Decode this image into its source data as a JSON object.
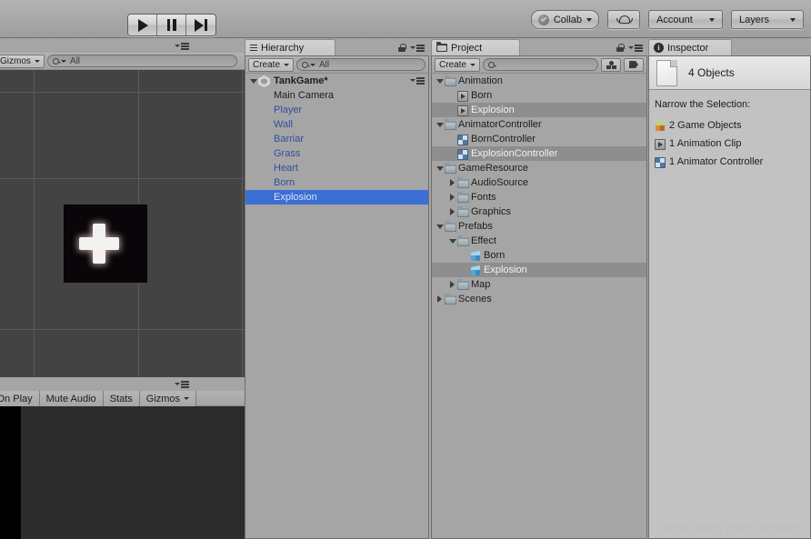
{
  "toolbar": {
    "play_icon": "play-icon",
    "pause_icon": "pause-icon",
    "step_icon": "step-icon",
    "collab_label": "Collab",
    "cloud_icon": "cloud-icon",
    "account_label": "Account",
    "layers_label": "Layers"
  },
  "scene_view": {
    "gizmos_label": "Gizmos",
    "search_value": "All",
    "sprite_name": "explosion-sprite"
  },
  "game_view": {
    "buttons": [
      "Maximize On Play",
      "Mute Audio",
      "Stats",
      "Gizmos"
    ]
  },
  "hierarchy": {
    "tab_label": "Hierarchy",
    "create_label": "Create",
    "search_value": "All",
    "scene_name": "TankGame*",
    "items": [
      {
        "label": "Main Camera",
        "style": "plain",
        "selected": false
      },
      {
        "label": "Player",
        "style": "prefab",
        "selected": false
      },
      {
        "label": "Wall",
        "style": "prefab",
        "selected": false
      },
      {
        "label": "Barriar",
        "style": "prefab",
        "selected": false
      },
      {
        "label": "Grass",
        "style": "prefab",
        "selected": false
      },
      {
        "label": "Heart",
        "style": "prefab",
        "selected": false
      },
      {
        "label": "Born",
        "style": "prefab",
        "selected": false
      },
      {
        "label": "Explosion",
        "style": "prefab",
        "selected": true
      }
    ]
  },
  "project": {
    "tab_label": "Project",
    "create_label": "Create",
    "search_placeholder": "",
    "items": [
      {
        "label": "Animation",
        "depth": 0,
        "twisty": "down",
        "icon": "folder",
        "selected": false
      },
      {
        "label": "Born",
        "depth": 1,
        "twisty": "none",
        "icon": "clip",
        "selected": false
      },
      {
        "label": "Explosion",
        "depth": 1,
        "twisty": "none",
        "icon": "clip",
        "selected": true
      },
      {
        "label": "AnimatorController",
        "depth": 0,
        "twisty": "down",
        "icon": "folder",
        "selected": false
      },
      {
        "label": "BornController",
        "depth": 1,
        "twisty": "none",
        "icon": "anim",
        "selected": false
      },
      {
        "label": "ExplosionController",
        "depth": 1,
        "twisty": "none",
        "icon": "anim",
        "selected": true
      },
      {
        "label": "GameResource",
        "depth": 0,
        "twisty": "down",
        "icon": "folder",
        "selected": false
      },
      {
        "label": "AudioSource",
        "depth": 1,
        "twisty": "right",
        "icon": "folder",
        "selected": false
      },
      {
        "label": "Fonts",
        "depth": 1,
        "twisty": "right",
        "icon": "folder",
        "selected": false
      },
      {
        "label": "Graphics",
        "depth": 1,
        "twisty": "right",
        "icon": "folder",
        "selected": false
      },
      {
        "label": "Prefabs",
        "depth": 0,
        "twisty": "down",
        "icon": "folder",
        "selected": false
      },
      {
        "label": "Effect",
        "depth": 1,
        "twisty": "down",
        "icon": "folder",
        "selected": false
      },
      {
        "label": "Born",
        "depth": 2,
        "twisty": "none",
        "icon": "prefab",
        "selected": false
      },
      {
        "label": "Explosion",
        "depth": 2,
        "twisty": "none",
        "icon": "prefab",
        "selected": true
      },
      {
        "label": "Map",
        "depth": 1,
        "twisty": "right",
        "icon": "folder",
        "selected": false
      },
      {
        "label": "Scenes",
        "depth": 0,
        "twisty": "right",
        "icon": "folder",
        "selected": false
      }
    ]
  },
  "inspector": {
    "tab_label": "Inspector",
    "selection_title": "4 Objects",
    "narrow_title": "Narrow the Selection:",
    "narrow_items": [
      {
        "label": "2 Game Objects",
        "icon": "go"
      },
      {
        "label": "1 Animation Clip",
        "icon": "clip"
      },
      {
        "label": "1 Animator Controller",
        "icon": "anim"
      }
    ]
  },
  "watermark": "https://blog.csdn.net/Bilter",
  "colors": {
    "selection_blue": "#3b6fd4",
    "selection_grey": "#8e8e8e",
    "panel_bg": "#a5a5a5",
    "scene_bg": "#434343",
    "prefab_text": "#2f4f9e"
  }
}
